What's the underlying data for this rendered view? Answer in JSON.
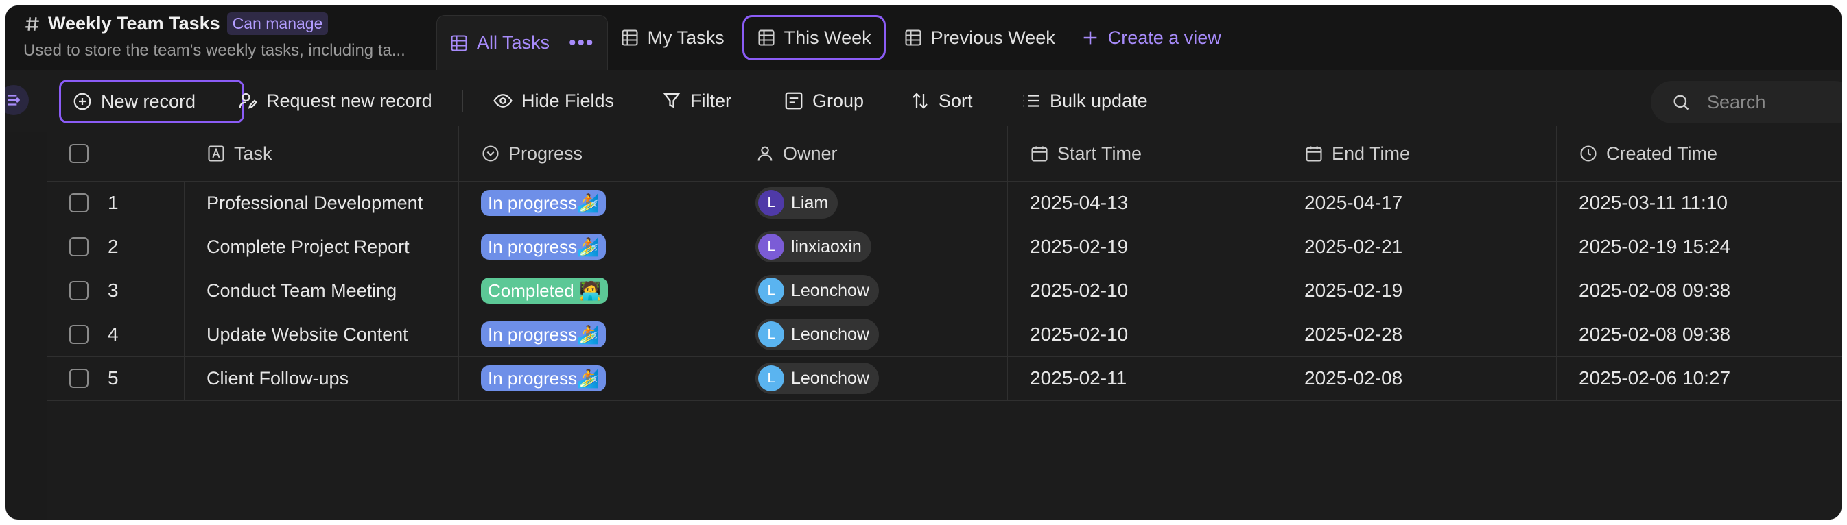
{
  "header": {
    "title": "Weekly Team Tasks",
    "permission": "Can manage",
    "description": "Used to store the team's weekly tasks, including ta..."
  },
  "tabs": [
    {
      "label": "All Tasks",
      "icon": "grid-table-icon",
      "active": true
    },
    {
      "label": "My Tasks",
      "icon": "grid-table-icon"
    },
    {
      "label": "This Week",
      "icon": "grid-table-icon",
      "highlighted": true
    },
    {
      "label": "Previous Week",
      "icon": "grid-table-icon"
    },
    {
      "label": "Create a view",
      "icon": "plus-icon"
    }
  ],
  "toolbar": {
    "new_record": "New record",
    "request_new_record": "Request new record",
    "hide_fields": "Hide Fields",
    "filter": "Filter",
    "group": "Group",
    "sort": "Sort",
    "bulk_update": "Bulk update",
    "search_placeholder": "Search"
  },
  "columns": [
    "Task",
    "Progress",
    "Owner",
    "Start Time",
    "End Time",
    "Created Time"
  ],
  "rows": [
    {
      "num": "1",
      "task": "Professional Development",
      "progress": "In progress🏄",
      "owner": "Liam",
      "owner_initial": "L",
      "start": "2025-04-13",
      "end": "2025-04-17",
      "created": "2025-03-11 11:10"
    },
    {
      "num": "2",
      "task": "Complete Project Report",
      "progress": "In progress🏄",
      "owner": "linxiaoxin",
      "owner_initial": "L",
      "start": "2025-02-19",
      "end": "2025-02-21",
      "created": "2025-02-19 15:24"
    },
    {
      "num": "3",
      "task": "Conduct Team Meeting",
      "progress": "Completed 🧑‍💻",
      "owner": "Leonchow",
      "owner_initial": "L",
      "start": "2025-02-10",
      "end": "2025-02-19",
      "created": "2025-02-08 09:38"
    },
    {
      "num": "4",
      "task": "Update Website Content",
      "progress": "In progress🏄",
      "owner": "Leonchow",
      "owner_initial": "L",
      "start": "2025-02-10",
      "end": "2025-02-28",
      "created": "2025-02-08 09:38"
    },
    {
      "num": "5",
      "task": "Client Follow-ups",
      "progress": "In progress🏄",
      "owner": "Leonchow",
      "owner_initial": "L",
      "start": "2025-02-11",
      "end": "2025-02-08",
      "created": "2025-02-06 10:27"
    }
  ],
  "colors": {
    "accent": "#8b5cf6",
    "in_progress": "#6e8fe8",
    "completed": "#5cc896",
    "avatar_liam": "#4f3aa8",
    "avatar_linxiaoxin": "#7b5cd6",
    "avatar_leonchow": "#5ab4f0"
  }
}
